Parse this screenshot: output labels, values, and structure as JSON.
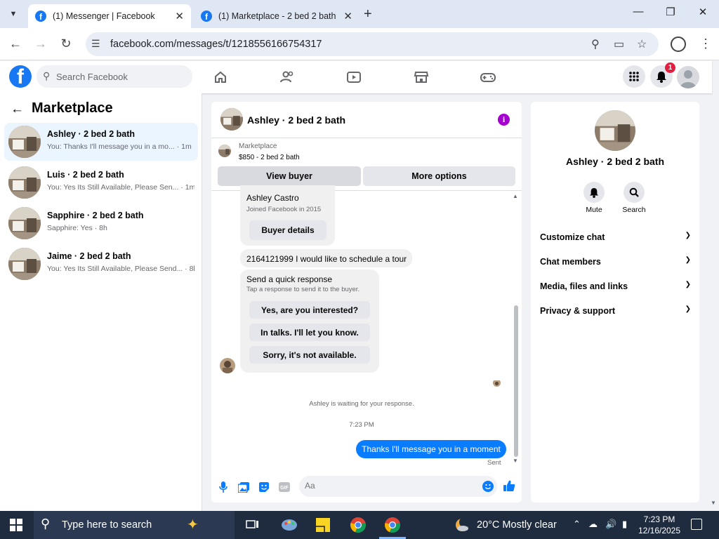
{
  "browser": {
    "tabs": [
      {
        "title": "(1) Messenger | Facebook",
        "active": true
      },
      {
        "title": "(1) Marketplace - 2 bed 2 bath",
        "active": false
      }
    ],
    "url": "facebook.com/messages/t/1218556166754317"
  },
  "fb_header": {
    "search_placeholder": "Search Facebook",
    "notification_count": "1",
    "nav_icons": [
      "home-icon",
      "friends-icon",
      "video-icon",
      "marketplace-icon",
      "gaming-icon"
    ]
  },
  "left_panel": {
    "title": "Marketplace",
    "conversations": [
      {
        "name": "Ashley · 2 bed 2 bath",
        "snippet": "You: Thanks I'll message you in a mo...",
        "time": "· 1m",
        "active": true
      },
      {
        "name": "Luis · 2 bed 2 bath",
        "snippet": "You: Yes Its Still Available, Please Sen...",
        "time": "· 1m",
        "active": false
      },
      {
        "name": "Sapphire · 2 bed 2 bath",
        "snippet": "Sapphire: Yes",
        "time": "· 8h",
        "active": false
      },
      {
        "name": "Jaime · 2 bed 2 bath",
        "snippet": "You: Yes Its Still Available, Please Send...",
        "time": "· 8h",
        "active": false
      }
    ]
  },
  "chat": {
    "header_name": "Ashley · 2 bed 2 bath",
    "marketplace_label": "Marketplace",
    "listing": "$850 - 2 bed 2 bath",
    "view_buyer": "View buyer",
    "more_options": "More options",
    "buyer_card": {
      "name": "Ashley Castro",
      "joined": "Joined Facebook in 2015",
      "button": "Buyer details"
    },
    "incoming_message": "2164121999 I would like to schedule a tour",
    "quick_response": {
      "title": "Send a quick response",
      "subtitle": "Tap a response to send it to the buyer.",
      "options": [
        "Yes, are you interested?",
        "In talks. I'll let you know.",
        "Sorry, it's not available."
      ]
    },
    "waiting_text": "Ashley is waiting for your response.",
    "timestamp": "7:23 PM",
    "sent_message": "Thanks I'll message you in a moment",
    "sent_status": "Sent",
    "composer_placeholder": "Aa"
  },
  "right_panel": {
    "name": "Ashley · 2 bed 2 bath",
    "actions": [
      {
        "label": "Mute",
        "icon": "bell-icon"
      },
      {
        "label": "Search",
        "icon": "search-icon"
      }
    ],
    "sections": [
      "Customize chat",
      "Chat members",
      "Media, files and links",
      "Privacy & support"
    ]
  },
  "taskbar": {
    "search_placeholder": "Type here to search",
    "weather": "20°C  Mostly clear",
    "time": "7:23 PM",
    "date": "12/16/2025"
  },
  "colors": {
    "fb_blue": "#1877f2",
    "messenger_blue": "#0a7cff",
    "active_conversation": "#ebf5ff",
    "taskbar": "#1f2b3e"
  }
}
